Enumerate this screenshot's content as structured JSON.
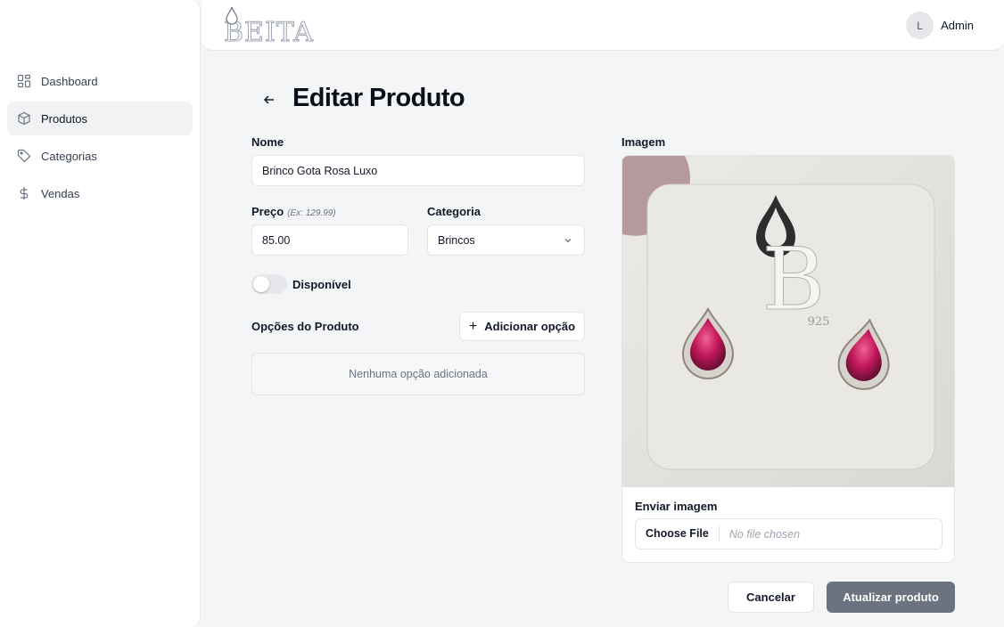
{
  "app": {
    "logo_text": "BEITA"
  },
  "user": {
    "initial": "L",
    "name": "Admin"
  },
  "sidebar": {
    "items": [
      {
        "label": "Dashboard",
        "icon": "dashboard-grid-icon",
        "active": false
      },
      {
        "label": "Produtos",
        "icon": "box-icon",
        "active": true
      },
      {
        "label": "Categorias",
        "icon": "tag-icon",
        "active": false
      },
      {
        "label": "Vendas",
        "icon": "dollar-icon",
        "active": false
      }
    ]
  },
  "page": {
    "title": "Editar Produto",
    "back_icon": "arrow-left-icon"
  },
  "form": {
    "name": {
      "label": "Nome",
      "value": "Brinco Gota Rosa Luxo"
    },
    "price": {
      "label": "Preço",
      "hint": "(Ex: 129.99)",
      "value": "85.00"
    },
    "category": {
      "label": "Categoria",
      "value": "Brincos",
      "icon": "chevron-down-icon"
    },
    "available": {
      "label": "Disponível",
      "checked": false
    },
    "options": {
      "label": "Opções do Produto",
      "add_label": "Adicionar opção",
      "add_icon": "plus-icon",
      "empty_text": "Nenhuma opção adicionada"
    },
    "image": {
      "label": "Imagem",
      "card_mark": "B",
      "card_hallmark": "925",
      "upload_label": "Enviar imagem",
      "file_button": "Choose File",
      "file_status": "No file chosen"
    }
  },
  "actions": {
    "cancel": "Cancelar",
    "submit": "Atualizar produto"
  },
  "colors": {
    "primary_disabled": "#6b7280",
    "background": "#f4f5f7",
    "jewel": "#c2185b"
  }
}
